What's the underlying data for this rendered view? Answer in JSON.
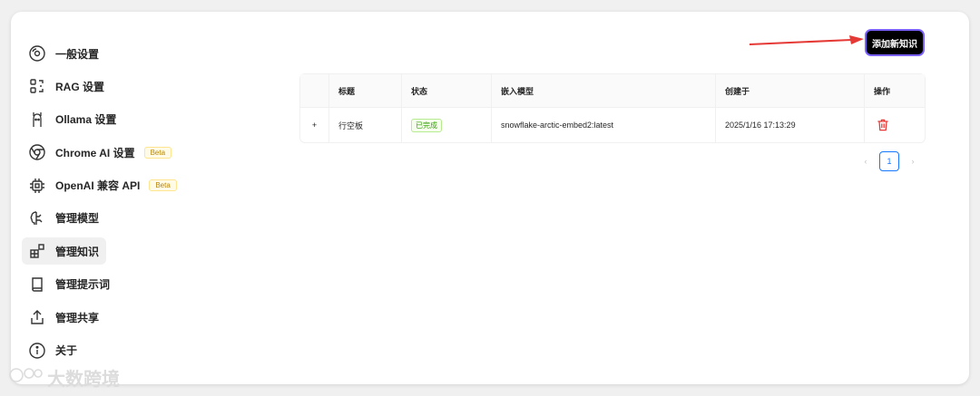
{
  "sidebar": {
    "items": [
      {
        "label": "一般设置",
        "icon": "settings-icon"
      },
      {
        "label": "RAG 设置",
        "icon": "rag-icon"
      },
      {
        "label": "Ollama 设置",
        "icon": "ollama-icon"
      },
      {
        "label": "Chrome AI 设置",
        "icon": "chrome-icon",
        "badge": "Beta"
      },
      {
        "label": "OpenAI 兼容 API",
        "icon": "chip-icon",
        "badge": "Beta"
      },
      {
        "label": "管理模型",
        "icon": "brain-icon"
      },
      {
        "label": "管理知识",
        "icon": "blocks-icon",
        "active": true
      },
      {
        "label": "管理提示词",
        "icon": "book-icon"
      },
      {
        "label": "管理共享",
        "icon": "share-icon"
      },
      {
        "label": "关于",
        "icon": "info-icon"
      }
    ]
  },
  "toolbar": {
    "add_label": "添加新知识"
  },
  "table": {
    "columns": [
      "",
      "标题",
      "状态",
      "嵌入模型",
      "创建于",
      "操作"
    ],
    "rows": [
      {
        "expand": "+",
        "title": "行空板",
        "status": "已完成",
        "model": "snowflake-arctic-embed2:latest",
        "created": "2025/1/16 17:13:29",
        "action_icon": "trash-icon"
      }
    ]
  },
  "pagination": {
    "prev": "‹",
    "current": "1",
    "next": "›"
  },
  "watermark": "大数跨境",
  "colors": {
    "accent": "#000000",
    "danger": "#e53935",
    "success": "#389e0d",
    "primary": "#1677ff",
    "arrow": "#e53935"
  }
}
